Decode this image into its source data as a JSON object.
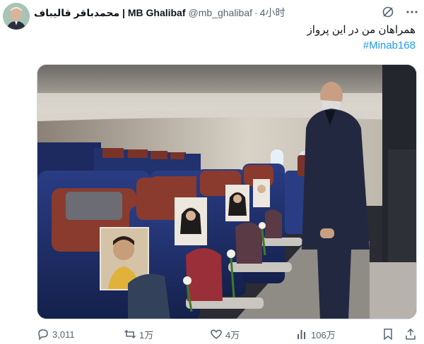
{
  "post": {
    "display_name": "محمدباقر قالیباف | MB Ghalibaf",
    "handle": "@mb_ghalibaf",
    "separator": "·",
    "time": "4小时",
    "text": "همراهان من در این پرواز",
    "hashtag": "#Minab168"
  },
  "icons": {
    "grok": "grok-icon",
    "more": "more-icon",
    "reply": "reply-icon",
    "repost": "repost-icon",
    "like": "like-icon",
    "views": "views-icon",
    "bookmark": "bookmark-icon",
    "share": "share-icon"
  },
  "actions": {
    "replies": "3,011",
    "reposts": "1万",
    "likes": "4万",
    "views": "106万"
  },
  "colors": {
    "link": "#1d9bf0",
    "secondary_text": "#536471",
    "text": "#0f1419",
    "seat_blue": "#1e2f6b",
    "headrest_red": "#8a3b2e"
  }
}
